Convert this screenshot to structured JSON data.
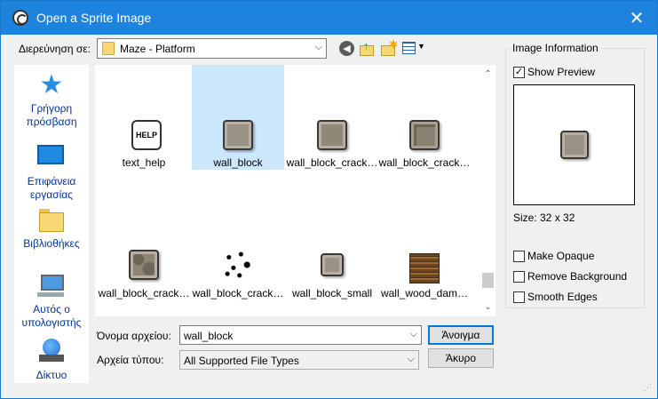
{
  "window": {
    "title": "Open a Sprite Image",
    "close_glyph": "✕"
  },
  "lookin": {
    "label": "Διερεύνηση σε:",
    "value": "Maze - Platform"
  },
  "sidebar": {
    "items": [
      {
        "label": "Γρήγορη πρόσβαση",
        "icon": "star-icon"
      },
      {
        "label": "Επιφάνεια εργασίας",
        "icon": "desktop-icon"
      },
      {
        "label": "Βιβλιοθήκες",
        "icon": "libraries-icon"
      },
      {
        "label": "Αυτός ο υπολογιστής",
        "icon": "computer-icon"
      },
      {
        "label": "Δίκτυο",
        "icon": "network-icon"
      }
    ]
  },
  "files": [
    {
      "label": "text_help",
      "thumb": "help",
      "thumb_text": "HELP"
    },
    {
      "label": "wall_block",
      "thumb": "stone",
      "selected": true
    },
    {
      "label": "wall_block_crack…",
      "thumb": "stone cr1"
    },
    {
      "label": "wall_block_crack…",
      "thumb": "stone cr2"
    },
    {
      "label": "wall_block_crack…",
      "thumb": "stone cr3"
    },
    {
      "label": "wall_block_crack…",
      "thumb": "dots"
    },
    {
      "label": "wall_block_small",
      "thumb": "stone small"
    },
    {
      "label": "wall_wood_dam…",
      "thumb": "wood"
    }
  ],
  "filename": {
    "label": "Όνομα αρχείου:",
    "value": "wall_block"
  },
  "filetype": {
    "label": "Αρχεία τύπου:",
    "value": "All Supported File Types"
  },
  "buttons": {
    "open": "Άνοιγμα",
    "cancel": "Άκυρο"
  },
  "info": {
    "title": "Image Information",
    "show_preview": {
      "label": "Show Preview",
      "checked": true
    },
    "size": "Size: 32 x 32",
    "make_opaque": {
      "label": "Make Opaque",
      "checked": false
    },
    "remove_background": {
      "label": "Remove Background",
      "checked": false
    },
    "smooth_edges": {
      "label": "Smooth Edges",
      "checked": false
    }
  }
}
